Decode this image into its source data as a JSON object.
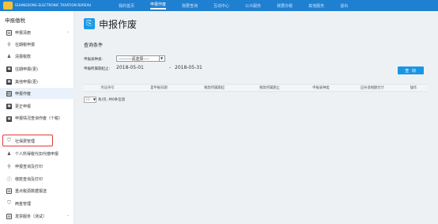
{
  "topbar": {
    "brand_line1": "",
    "brand_line2": "GUANGDONG ELECTRONIC TAXATION BUREAU",
    "nav": [
      "我的首页",
      "申报作废",
      "我要查询",
      "互动中心",
      "公众服务",
      "我要办税",
      "其他服务",
      "退出"
    ]
  },
  "sidebar": {
    "title": "申报缴税",
    "items": [
      {
        "label": "申报清册",
        "icon": "list-icon",
        "chevron": true
      },
      {
        "label": "在期税申报",
        "icon": "search-icon"
      },
      {
        "label": "清报税款",
        "icon": "person-icon"
      },
      {
        "label": "往期申报(更)",
        "icon": "box-icon"
      },
      {
        "label": "其他申报(更)",
        "icon": "box-icon"
      },
      {
        "label": "申报作废",
        "icon": "document-icon"
      },
      {
        "label": "更正申报",
        "icon": "box-icon"
      },
      {
        "label": "申报情况查询作废（个税）",
        "icon": "box-icon"
      },
      {
        "label": "社保费管理",
        "icon": "shield-icon"
      },
      {
        "label": "个人所得税代扣代缴申报",
        "icon": "person-icon"
      },
      {
        "label": "申报查询及打印",
        "icon": "search-icon"
      },
      {
        "label": "缴款查询及打印",
        "icon": "info-icon"
      },
      {
        "label": "重点税源数据报送",
        "icon": "list-icon"
      },
      {
        "label": "两金管理",
        "icon": "shield-icon"
      },
      {
        "label": "发票服务（测试）",
        "icon": "list-icon",
        "chevron": true
      }
    ]
  },
  "main": {
    "title": "申报作废",
    "section": "查询条件",
    "form": {
      "type_label": "申报表种类:",
      "type_value": "---------请选择----",
      "period_label": "申报所属期起止:",
      "date_from": "2018-05-01",
      "date_to": "2018-05-31",
      "query_button": "查 询"
    },
    "table": {
      "headers": [
        "凭证序号",
        "是申报日期",
        "税款所属期起",
        "税款所属期止",
        "申报表种类",
        "应补退税额合计",
        "操作"
      ]
    },
    "pager": {
      "page_size": "10",
      "text": "条/页, 共0条信息"
    }
  }
}
